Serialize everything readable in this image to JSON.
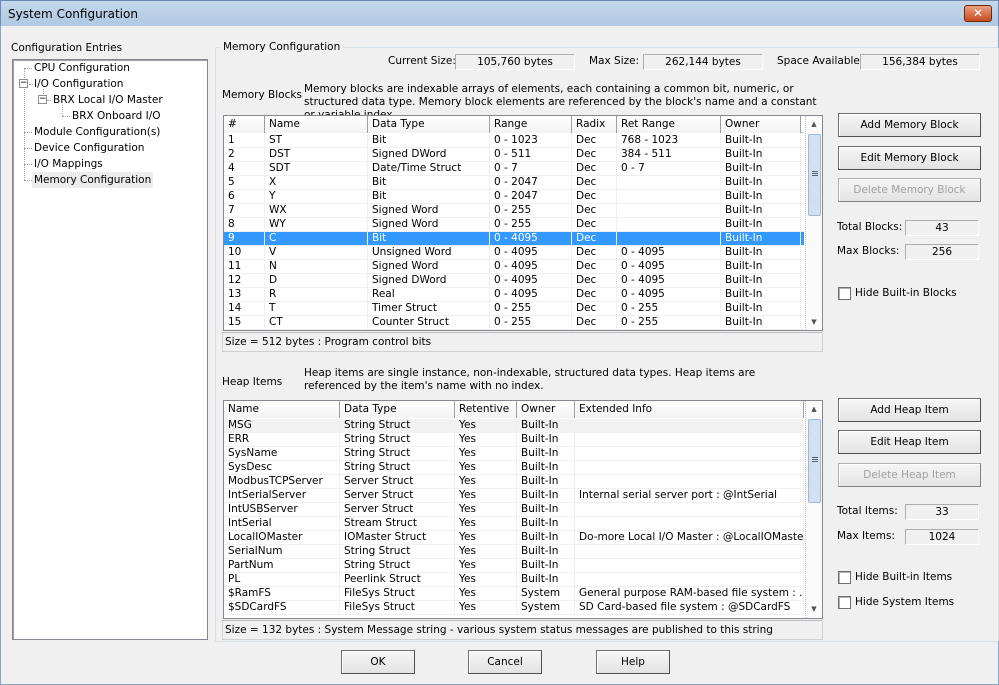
{
  "window": {
    "title": "System Configuration",
    "close_symbol": "✕"
  },
  "sidebar": {
    "heading": "Configuration Entries",
    "items": [
      {
        "label": "CPU Configuration",
        "level": 0
      },
      {
        "label": "I/O Configuration",
        "level": 0,
        "expanded": true
      },
      {
        "label": "BRX Local I/O Master",
        "level": 1,
        "expanded": true
      },
      {
        "label": "BRX Onboard I/O",
        "level": 2
      },
      {
        "label": "Module Configuration(s)",
        "level": 0
      },
      {
        "label": "Device Configuration",
        "level": 0
      },
      {
        "label": "I/O Mappings",
        "level": 0
      },
      {
        "label": "Memory Configuration",
        "level": 0,
        "selected": true
      }
    ],
    "expander_symbol": "−"
  },
  "memory_config": {
    "group_title": "Memory Configuration",
    "current_size_label": "Current Size:",
    "current_size": "105,760 bytes",
    "max_size_label": "Max Size:",
    "max_size": "262,144 bytes",
    "space_available_label": "Space Available:",
    "space_available": "156,384 bytes"
  },
  "memory_blocks": {
    "label": "Memory Blocks",
    "description": "Memory blocks are indexable arrays of elements, each containing a common bit, numeric, or structured data type. Memory block elements are referenced by the block's name and a constant or variable index.",
    "columns": [
      "#",
      "Name",
      "Data Type",
      "Range",
      "Radix",
      "Ret Range",
      "Owner"
    ],
    "rows": [
      [
        "1",
        "ST",
        "Bit",
        "0 - 1023",
        "Dec",
        "768 - 1023",
        "Built-In"
      ],
      [
        "2",
        "DST",
        "Signed DWord",
        "0 - 511",
        "Dec",
        "384 - 511",
        "Built-In"
      ],
      [
        "4",
        "SDT",
        "Date/Time Struct",
        "0 - 7",
        "Dec",
        "0 - 7",
        "Built-In"
      ],
      [
        "5",
        "X",
        "Bit",
        "0 - 2047",
        "Dec",
        "",
        "Built-In"
      ],
      [
        "6",
        "Y",
        "Bit",
        "0 - 2047",
        "Dec",
        "",
        "Built-In"
      ],
      [
        "7",
        "WX",
        "Signed Word",
        "0 - 255",
        "Dec",
        "",
        "Built-In"
      ],
      [
        "8",
        "WY",
        "Signed Word",
        "0 - 255",
        "Dec",
        "",
        "Built-In"
      ],
      [
        "9",
        "C",
        "Bit",
        "0 - 4095",
        "Dec",
        "",
        "Built-In"
      ],
      [
        "10",
        "V",
        "Unsigned Word",
        "0 - 4095",
        "Dec",
        "0 - 4095",
        "Built-In"
      ],
      [
        "11",
        "N",
        "Signed Word",
        "0 - 4095",
        "Dec",
        "0 - 4095",
        "Built-In"
      ],
      [
        "12",
        "D",
        "Signed DWord",
        "0 - 4095",
        "Dec",
        "0 - 4095",
        "Built-In"
      ],
      [
        "13",
        "R",
        "Real",
        "0 - 4095",
        "Dec",
        "0 - 4095",
        "Built-In"
      ],
      [
        "14",
        "T",
        "Timer Struct",
        "0 - 255",
        "Dec",
        "0 - 255",
        "Built-In"
      ],
      [
        "15",
        "CT",
        "Counter Struct",
        "0 - 255",
        "Dec",
        "0 - 255",
        "Built-In"
      ]
    ],
    "selected_row": 7,
    "status": "Size = 512 bytes : Program control bits",
    "buttons": {
      "add": "Add Memory Block",
      "edit": "Edit Memory Block",
      "delete": "Delete Memory Block"
    },
    "total_label": "Total Blocks:",
    "total": "43",
    "max_label": "Max Blocks:",
    "max": "256",
    "hide_builtin_label": "Hide Built-in Blocks",
    "hide_builtin_checked": false
  },
  "heap_items": {
    "label": "Heap Items",
    "description": "Heap items are single instance, non-indexable, structured data types. Heap items are referenced by the item's name with no index.",
    "columns": [
      "Name",
      "Data Type",
      "Retentive",
      "Owner",
      "Extended Info"
    ],
    "rows": [
      [
        "MSG",
        "String Struct",
        "Yes",
        "Built-In",
        ""
      ],
      [
        "ERR",
        "String Struct",
        "Yes",
        "Built-In",
        ""
      ],
      [
        "SysName",
        "String Struct",
        "Yes",
        "Built-In",
        ""
      ],
      [
        "SysDesc",
        "String Struct",
        "Yes",
        "Built-In",
        ""
      ],
      [
        "ModbusTCPServer",
        "Server Struct",
        "Yes",
        "Built-In",
        ""
      ],
      [
        "IntSerialServer",
        "Server Struct",
        "Yes",
        "Built-In",
        "Internal serial server port : @IntSerial"
      ],
      [
        "IntUSBServer",
        "Server Struct",
        "Yes",
        "Built-In",
        ""
      ],
      [
        "IntSerial",
        "Stream Struct",
        "Yes",
        "Built-In",
        ""
      ],
      [
        "LocalIOMaster",
        "IOMaster Struct",
        "Yes",
        "Built-In",
        "Do-more Local I/O Master : @LocalIOMaster"
      ],
      [
        "SerialNum",
        "String Struct",
        "Yes",
        "Built-In",
        ""
      ],
      [
        "PartNum",
        "String Struct",
        "Yes",
        "Built-In",
        ""
      ],
      [
        "PL",
        "Peerlink Struct",
        "Yes",
        "Built-In",
        ""
      ],
      [
        "$RamFS",
        "FileSys Struct",
        "Yes",
        "System",
        "General purpose RAM-based file system : ..."
      ],
      [
        "$SDCardFS",
        "FileSys Struct",
        "Yes",
        "System",
        "SD Card-based file system : @SDCardFS"
      ]
    ],
    "focused_row": 0,
    "status": "Size = 132 bytes : System Message string - various system status messages are published to this string",
    "buttons": {
      "add": "Add Heap Item",
      "edit": "Edit Heap Item",
      "delete": "Delete Heap Item"
    },
    "total_label": "Total Items:",
    "total": "33",
    "max_label": "Max Items:",
    "max": "1024",
    "hide_builtin_label": "Hide Built-in Items",
    "hide_builtin_checked": false,
    "hide_system_label": "Hide System Items",
    "hide_system_checked": false
  },
  "scroll": {
    "up_symbol": "▲",
    "down_symbol": "▼"
  },
  "footer": {
    "ok": "OK",
    "cancel": "Cancel",
    "help": "Help"
  }
}
